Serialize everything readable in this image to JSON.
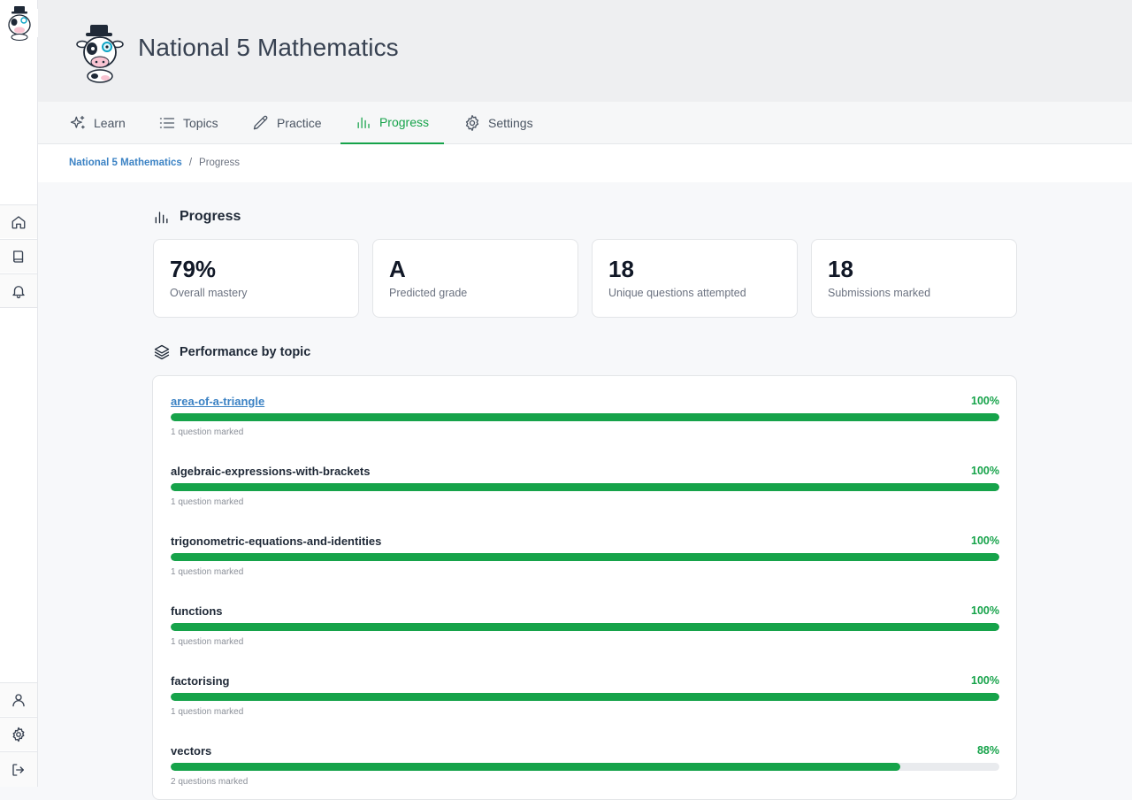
{
  "header": {
    "title": "National 5 Mathematics"
  },
  "tabs": [
    {
      "label": "Learn",
      "icon": "sparkles-icon",
      "active": false
    },
    {
      "label": "Topics",
      "icon": "list-icon",
      "active": false
    },
    {
      "label": "Practice",
      "icon": "pencil-icon",
      "active": false
    },
    {
      "label": "Progress",
      "icon": "bar-chart-icon",
      "active": true
    },
    {
      "label": "Settings",
      "icon": "gear-icon",
      "active": false
    }
  ],
  "breadcrumb": {
    "parent": "National 5 Mathematics",
    "separator": "/",
    "current": "Progress"
  },
  "progress": {
    "title": "Progress",
    "stats": [
      {
        "value": "79%",
        "label": "Overall mastery"
      },
      {
        "value": "A",
        "label": "Predicted grade"
      },
      {
        "value": "18",
        "label": "Unique questions attempted"
      },
      {
        "value": "18",
        "label": "Submissions marked"
      }
    ]
  },
  "performance": {
    "title": "Performance by topic",
    "topics": [
      {
        "name": "area-of-a-triangle",
        "percent": "100%",
        "fraction": 1.0,
        "marked": "1 question marked",
        "link": true
      },
      {
        "name": "algebraic-expressions-with-brackets",
        "percent": "100%",
        "fraction": 1.0,
        "marked": "1 question marked",
        "link": false
      },
      {
        "name": "trigonometric-equations-and-identities",
        "percent": "100%",
        "fraction": 1.0,
        "marked": "1 question marked",
        "link": false
      },
      {
        "name": "functions",
        "percent": "100%",
        "fraction": 1.0,
        "marked": "1 question marked",
        "link": false
      },
      {
        "name": "factorising",
        "percent": "100%",
        "fraction": 1.0,
        "marked": "1 question marked",
        "link": false
      },
      {
        "name": "vectors",
        "percent": "88%",
        "fraction": 0.88,
        "marked": "2 questions marked",
        "link": false
      }
    ]
  },
  "colors": {
    "accent": "#16a34a",
    "link": "#3b82c4",
    "track": "#e9ebee"
  },
  "rail": {
    "top_icons": [
      "home-icon",
      "book-icon",
      "bell-icon"
    ],
    "bottom_icons": [
      "user-icon",
      "gear-icon",
      "logout-icon"
    ]
  }
}
